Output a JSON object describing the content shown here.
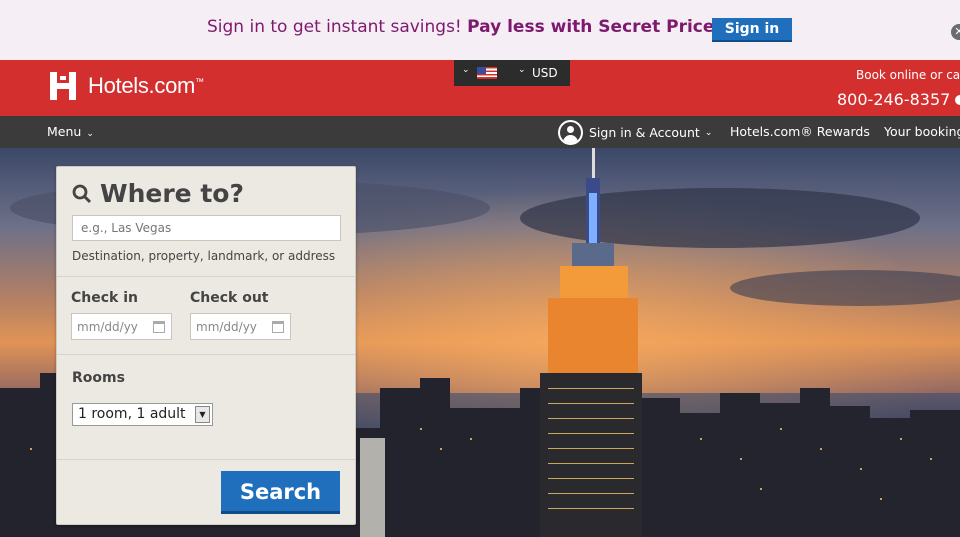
{
  "promo": {
    "text": "Sign in to get instant savings! ",
    "highlight": "Pay less with Secret Prices.",
    "signin_label": "Sign in",
    "close_glyph": "✕"
  },
  "header": {
    "logo_text": "Hotels.com",
    "logo_tm": "™",
    "locale": {
      "currency": "USD",
      "flag": "us-flag-icon"
    },
    "book_online": "Book online or ca",
    "phone": "800-246-8357"
  },
  "nav": {
    "menu_label": "Menu",
    "account_label": "Sign in & Account",
    "rewards_label": "Hotels.com® Rewards",
    "bookings_label": "Your booking"
  },
  "search": {
    "title": "Where to?",
    "destination_placeholder": "e.g., Las Vegas",
    "destination_hint": "Destination, property, landmark, or address",
    "checkin_label": "Check in",
    "checkout_label": "Check out",
    "date_placeholder": "mm/dd/yy",
    "rooms_label": "Rooms",
    "rooms_value": "1 room, 1 adult",
    "search_label": "Search"
  },
  "colors": {
    "brand_red": "#d32f2f",
    "action_blue": "#1f6fbd",
    "promo_purple": "#7d1a6e"
  }
}
